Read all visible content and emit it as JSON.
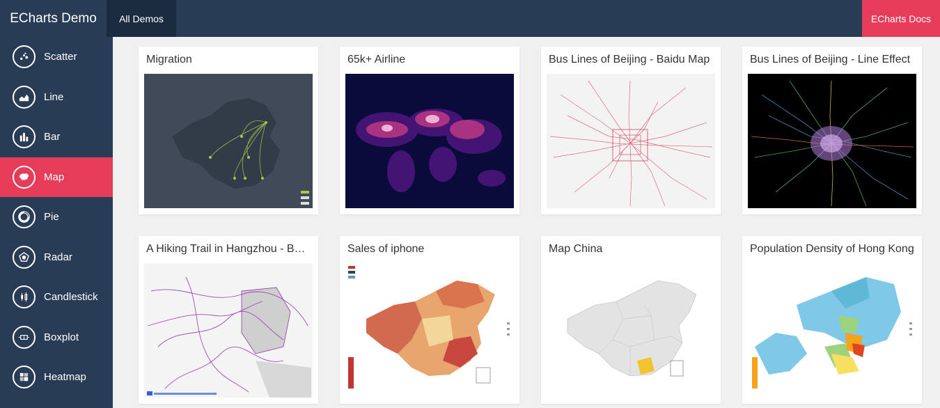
{
  "header": {
    "brand": "ECharts Demo",
    "nav_all": "All Demos",
    "nav_docs": "ECharts Docs",
    "accent": "#e43c59",
    "bar_color": "#293c55"
  },
  "sidebar": {
    "items": [
      {
        "label": "Scatter",
        "icon": "scatter-icon"
      },
      {
        "label": "Line",
        "icon": "line-chart-icon"
      },
      {
        "label": "Bar",
        "icon": "bar-chart-icon"
      },
      {
        "label": "Map",
        "icon": "map-icon",
        "active": true
      },
      {
        "label": "Pie",
        "icon": "pie-chart-icon"
      },
      {
        "label": "Radar",
        "icon": "radar-chart-icon"
      },
      {
        "label": "Candlestick",
        "icon": "candlestick-icon"
      },
      {
        "label": "Boxplot",
        "icon": "boxplot-icon"
      },
      {
        "label": "Heatmap",
        "icon": "heatmap-icon"
      }
    ]
  },
  "demos": [
    {
      "title": "Migration"
    },
    {
      "title": "65k+ Airline"
    },
    {
      "title": "Bus Lines of Beijing - Baidu Map"
    },
    {
      "title": "Bus Lines of Beijing - Line Effect"
    },
    {
      "title": "A Hiking Trail in Hangzhou - Baidu Map"
    },
    {
      "title": "Sales of iphone"
    },
    {
      "title": "Map China"
    },
    {
      "title": "Population Density of Hong Kong"
    }
  ]
}
